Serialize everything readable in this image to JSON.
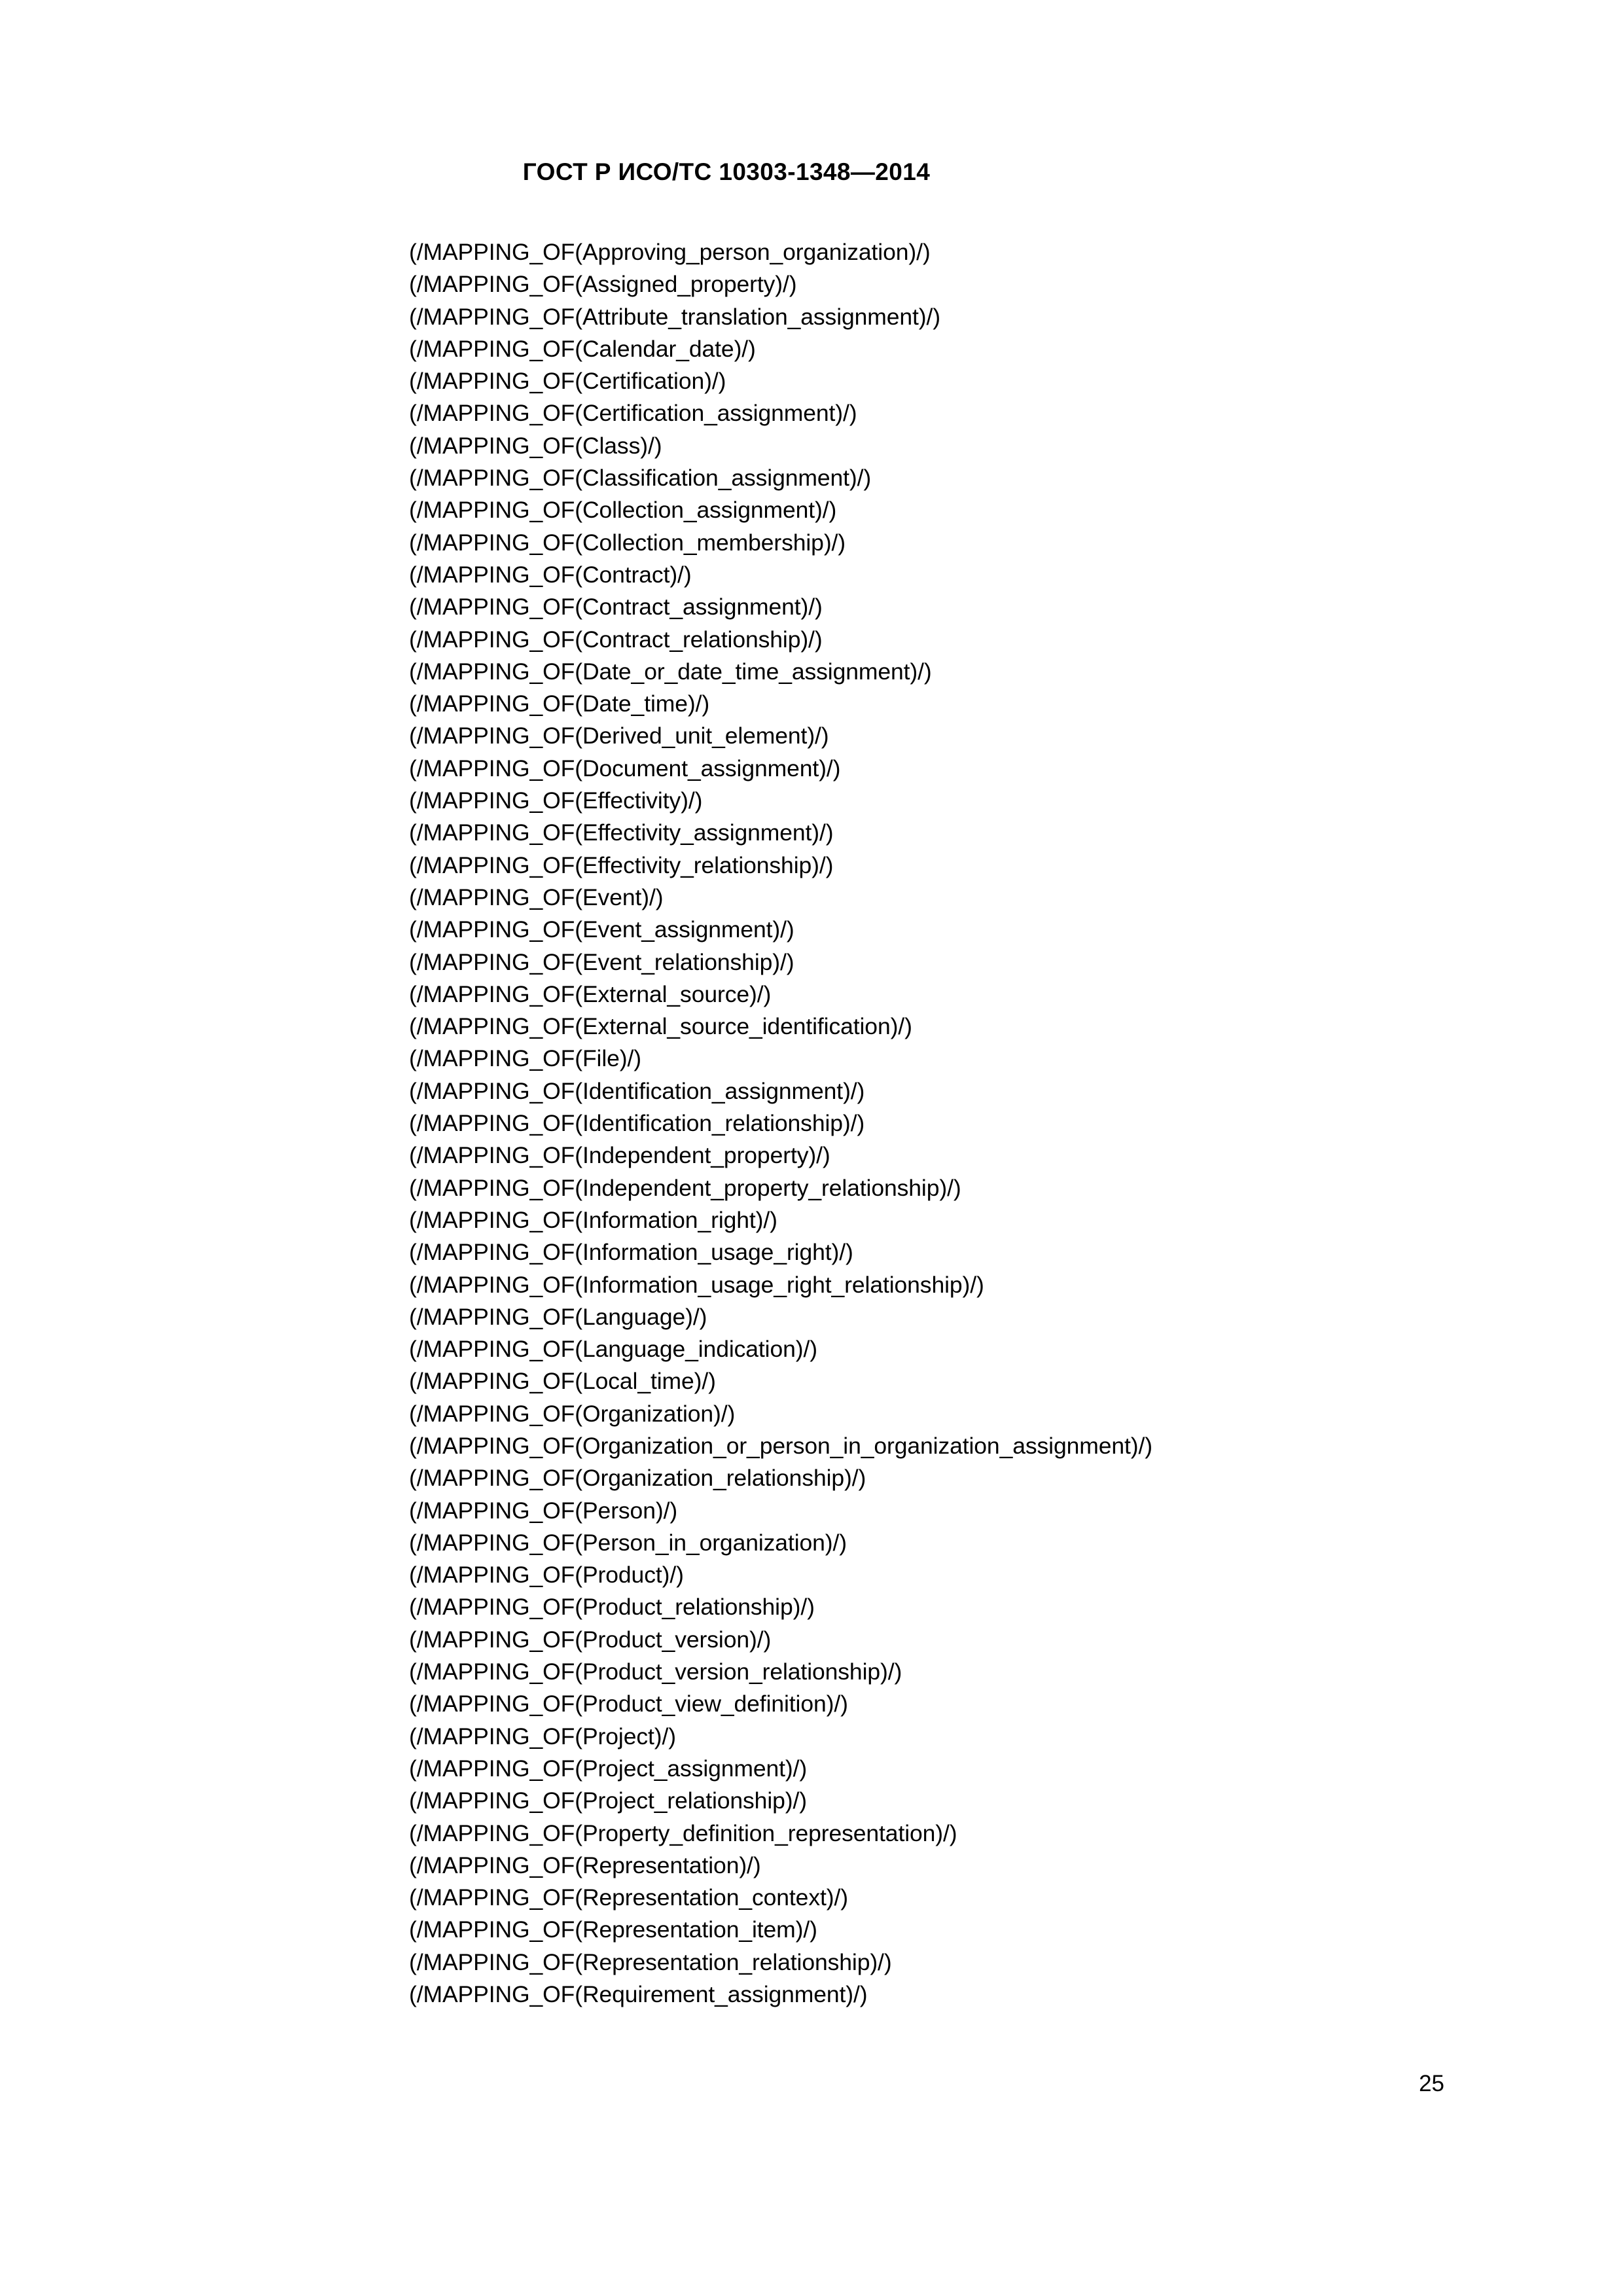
{
  "document": {
    "standard_header": "ГОСТ Р ИСО/ТС 10303-1348—2014",
    "page_number": "25"
  },
  "body": {
    "mapping_lines": [
      "(/MAPPING_OF(Approving_person_organization)/)",
      "(/MAPPING_OF(Assigned_property)/)",
      "(/MAPPING_OF(Attribute_translation_assignment)/)",
      "(/MAPPING_OF(Calendar_date)/)",
      "(/MAPPING_OF(Certification)/)",
      "(/MAPPING_OF(Certification_assignment)/)",
      "(/MAPPING_OF(Class)/)",
      "(/MAPPING_OF(Classification_assignment)/)",
      "(/MAPPING_OF(Collection_assignment)/)",
      "(/MAPPING_OF(Collection_membership)/)",
      "(/MAPPING_OF(Contract)/)",
      "(/MAPPING_OF(Contract_assignment)/)",
      "(/MAPPING_OF(Contract_relationship)/)",
      "(/MAPPING_OF(Date_or_date_time_assignment)/)",
      "(/MAPPING_OF(Date_time)/)",
      "(/MAPPING_OF(Derived_unit_element)/)",
      "(/MAPPING_OF(Document_assignment)/)",
      "(/MAPPING_OF(Effectivity)/)",
      "(/MAPPING_OF(Effectivity_assignment)/)",
      "(/MAPPING_OF(Effectivity_relationship)/)",
      "(/MAPPING_OF(Event)/)",
      "(/MAPPING_OF(Event_assignment)/)",
      "(/MAPPING_OF(Event_relationship)/)",
      "(/MAPPING_OF(External_source)/)",
      "(/MAPPING_OF(External_source_identification)/)",
      "(/MAPPING_OF(File)/)",
      "(/MAPPING_OF(Identification_assignment)/)",
      "(/MAPPING_OF(Identification_relationship)/)",
      "(/MAPPING_OF(Independent_property)/)",
      "(/MAPPING_OF(Independent_property_relationship)/)",
      "(/MAPPING_OF(Information_right)/)",
      "(/MAPPING_OF(Information_usage_right)/)",
      "(/MAPPING_OF(Information_usage_right_relationship)/)",
      "(/MAPPING_OF(Language)/)",
      "(/MAPPING_OF(Language_indication)/)",
      "(/MAPPING_OF(Local_time)/)",
      "(/MAPPING_OF(Organization)/)",
      "(/MAPPING_OF(Organization_or_person_in_organization_assignment)/)",
      "(/MAPPING_OF(Organization_relationship)/)",
      "(/MAPPING_OF(Person)/)",
      "(/MAPPING_OF(Person_in_organization)/)",
      "(/MAPPING_OF(Product)/)",
      "(/MAPPING_OF(Product_relationship)/)",
      "(/MAPPING_OF(Product_version)/)",
      "(/MAPPING_OF(Product_version_relationship)/)",
      "(/MAPPING_OF(Product_view_definition)/)",
      "(/MAPPING_OF(Project)/)",
      "(/MAPPING_OF(Project_assignment)/)",
      "(/MAPPING_OF(Project_relationship)/)",
      "(/MAPPING_OF(Property_definition_representation)/)",
      "(/MAPPING_OF(Representation)/)",
      "(/MAPPING_OF(Representation_context)/)",
      "(/MAPPING_OF(Representation_item)/)",
      "(/MAPPING_OF(Representation_relationship)/)",
      "(/MAPPING_OF(Requirement_assignment)/)"
    ]
  }
}
